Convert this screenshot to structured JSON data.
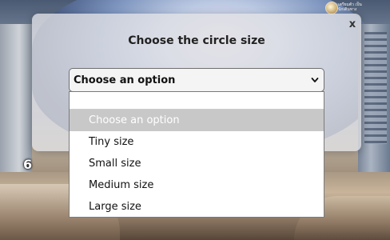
{
  "background": {
    "score": "6",
    "corner_badge": "เตรียมตัว เป็นนักเดินทาง"
  },
  "modal": {
    "title": "Choose the circle size",
    "close_label": "x",
    "select": {
      "value": "Choose an option",
      "icon": "chevron-down-icon"
    },
    "dropdown": {
      "search_value": "",
      "options": [
        "Choose an option",
        "Tiny size",
        "Small size",
        "Medium size",
        "Large size"
      ],
      "selected_index": 0
    }
  },
  "colors": {
    "modal_bg": "#e2e2e6",
    "option_highlight": "#c8c8c8",
    "text": "#111111"
  }
}
